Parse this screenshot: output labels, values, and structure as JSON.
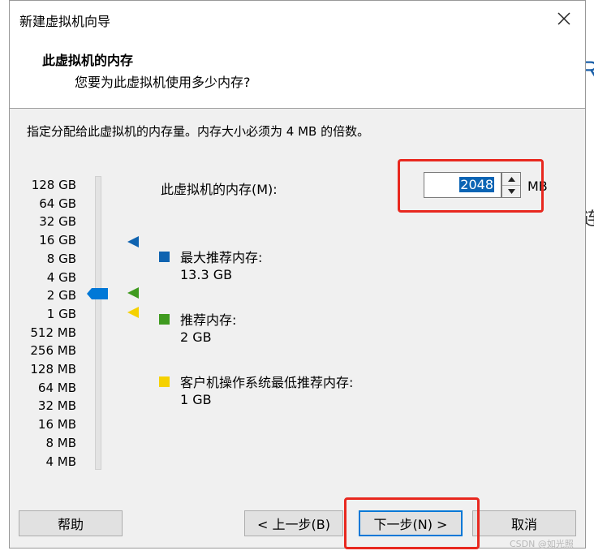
{
  "background": {
    "letter_r": "R",
    "char_lian": "连"
  },
  "window": {
    "title": "新建虚拟机向导"
  },
  "header": {
    "title": "此虚拟机的内存",
    "subtitle": "您要为此虚拟机使用多少内存?"
  },
  "instruction": "指定分配给此虚拟机的内存量。内存大小必须为 4 MB 的倍数。",
  "scale": [
    "128 GB",
    "64 GB",
    "32 GB",
    "16 GB",
    "8 GB",
    "4 GB",
    "2 GB",
    "1 GB",
    "512 MB",
    "256 MB",
    "128 MB",
    "64 MB",
    "32 MB",
    "16 MB",
    "8 MB",
    "4 MB"
  ],
  "memory": {
    "label": "此虚拟机的内存(M):",
    "value": "2048",
    "unit": "MB"
  },
  "legend": [
    {
      "label": "最大推荐内存:",
      "value": "13.3 GB",
      "color": "#0f63b0"
    },
    {
      "label": "推荐内存:",
      "value": "2 GB",
      "color": "#3f9a1f"
    },
    {
      "label": "客户机操作系统最低推荐内存:",
      "value": "1 GB",
      "color": "#f5d100"
    }
  ],
  "buttons": {
    "help": "帮助",
    "back": "< 上一步(B)",
    "next": "下一步(N) >",
    "cancel": "取消"
  },
  "colors": {
    "highlight": "#e8281f",
    "slider_thumb": "#0078d7",
    "selection": "#0a64b4"
  },
  "watermark": "CSDN @如光照"
}
